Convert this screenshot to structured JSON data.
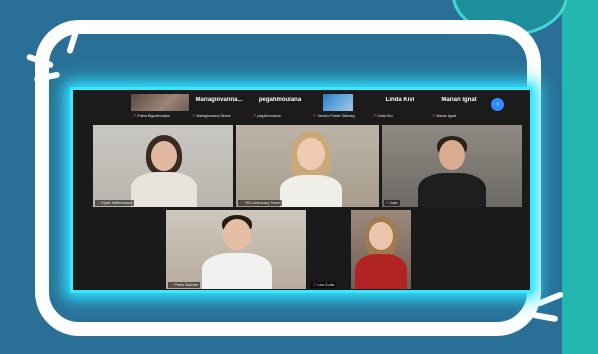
{
  "gallery": {
    "strip": [
      {
        "kind": "video",
        "label": "Polina Bigouteuclaire"
      },
      {
        "kind": "name",
        "name": "Mariagiovanna...",
        "label": "Mariagiovanna Sirena"
      },
      {
        "kind": "name",
        "name": "pegahmoulana",
        "label": "pegahmoulana"
      },
      {
        "kind": "screen",
        "label": "Yavolvo Pahler Ofamary"
      },
      {
        "kind": "name",
        "name": "Linda Kivi",
        "label": "Linda Kivi"
      },
      {
        "kind": "name",
        "name": "Marian Ignat",
        "label": "Marian Ignat"
      }
    ],
    "tiles": [
      {
        "label": "Elyse Hellemmant"
      },
      {
        "label": "YEU Advocacy Team"
      },
      {
        "label": "Ivan"
      },
      {
        "label": "Pietro Botcher"
      },
      {
        "label": "Lea Cudic"
      }
    ]
  }
}
